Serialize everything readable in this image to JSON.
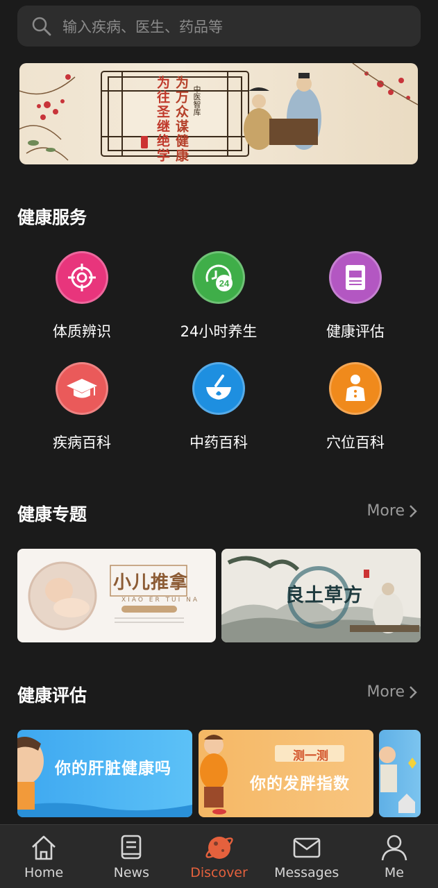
{
  "search": {
    "placeholder": "输入疾病、医生、药品等",
    "icon": "search-icon"
  },
  "banner": {
    "line1": "为往圣继绝学",
    "line2": "为万众谋健康",
    "brand": "中医智库"
  },
  "health_services": {
    "title": "健康服务",
    "items": [
      {
        "label": "体质辨识",
        "icon": "target-icon",
        "color": "#e8357c"
      },
      {
        "label": "24小时养生",
        "icon": "clock-24-icon",
        "color": "#3fae49"
      },
      {
        "label": "健康评估",
        "icon": "document-icon",
        "color": "#b357c2"
      },
      {
        "label": "疾病百科",
        "icon": "graduation-cap-icon",
        "color": "#ea5a5a"
      },
      {
        "label": "中药百科",
        "icon": "mortar-icon",
        "color": "#1e8fe0"
      },
      {
        "label": "穴位百科",
        "icon": "acupoint-figure-icon",
        "color": "#f08a1c"
      }
    ]
  },
  "health_topics": {
    "title": "健康专题",
    "more": "More",
    "cards": [
      {
        "title": "小儿推拿",
        "subtitle": "XIAO ER TUI NA"
      },
      {
        "title": "良土草方"
      }
    ]
  },
  "health_eval": {
    "title": "健康评估",
    "more": "More",
    "cards": [
      {
        "title": "你的肝脏健康吗"
      },
      {
        "tag": "测一测",
        "title": "你的发胖指数"
      }
    ]
  },
  "tabbar": {
    "items": [
      {
        "label": "Home",
        "icon": "home-icon",
        "active": false
      },
      {
        "label": "News",
        "icon": "book-icon",
        "active": false
      },
      {
        "label": "Discover",
        "icon": "planet-icon",
        "active": true
      },
      {
        "label": "Messages",
        "icon": "envelope-icon",
        "active": false
      },
      {
        "label": "Me",
        "icon": "person-icon",
        "active": false
      }
    ],
    "active_color": "#e5613d"
  }
}
